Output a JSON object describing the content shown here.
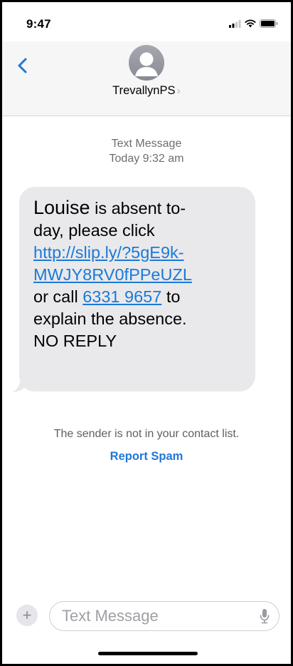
{
  "status_bar": {
    "time": "9:47",
    "icons": [
      "cellular-signal-icon",
      "wifi-icon",
      "battery-icon"
    ]
  },
  "header": {
    "back_icon": "chevron-left-icon",
    "avatar_icon": "person-silhouette-icon",
    "contact_name": "TrevallynPS",
    "contact_chevron": "›"
  },
  "conversation": {
    "service_label": "Text Message",
    "timestamp": "Today 9:32 am",
    "message": {
      "name": "Louise",
      "text_1": " is absent to-",
      "text_2": "day, please click",
      "link_line_1": "http://slip.ly/?5gE9k-",
      "link_line_2": "MWJY8RV0fPPeUZL",
      "text_3": "or call ",
      "phone_link": "6331 9657",
      "text_4": " to",
      "text_5": "explain the absence.",
      "text_6": "NO REPLY"
    },
    "sender_notice": "The sender is not in your contact list.",
    "report_spam_label": "Report Spam"
  },
  "composer": {
    "plus_label": "+",
    "placeholder": "Text Message",
    "mic_icon": "microphone-icon"
  },
  "colors": {
    "link": "#1a7ad9",
    "accent": "#1f77da",
    "bubble": "#e9e9eb",
    "header_bg": "#f6f6f6"
  }
}
